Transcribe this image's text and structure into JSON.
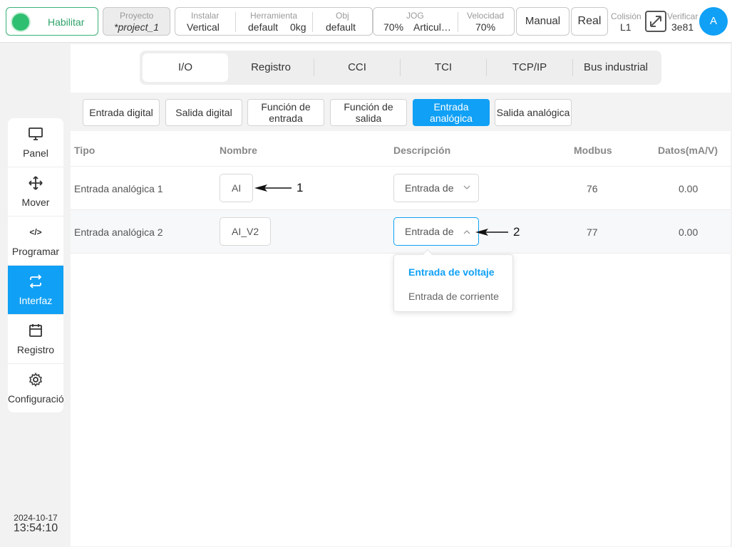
{
  "topbar": {
    "enable_label": "Habilitar",
    "project_label": "Proyecto",
    "project_value": "*project_1",
    "install_label": "Instalar",
    "install_value": "Vertical",
    "tool_label": "Herramienta",
    "tool_value": "default",
    "tool_weight": "0kg",
    "obj_label": "Obj",
    "obj_value": "default",
    "jog_label": "JOG",
    "jog_value": "70%",
    "jog_mode": "Articul…",
    "speed_label": "Velocidad",
    "speed_value": "70%",
    "manual_label": "Manual",
    "real_label": "Real",
    "collision_label": "Colisión",
    "collision_value": "L1",
    "verify_label": "Verificar",
    "verify_value": "3e81",
    "avatar_letter": "A",
    "accent_color": "#10a0f5",
    "enable_color": "#2fbf71"
  },
  "sidebar": {
    "items": [
      {
        "label": "Panel",
        "icon": "monitor-icon"
      },
      {
        "label": "Mover",
        "icon": "move-icon"
      },
      {
        "label": "Programar",
        "icon": "code-icon"
      },
      {
        "label": "Interfaz",
        "icon": "swap-icon"
      },
      {
        "label": "Registro",
        "icon": "calendar-icon"
      },
      {
        "label": "Configuración",
        "icon": "gear-icon"
      }
    ],
    "active": "Interfaz",
    "date": "2024-10-17",
    "time": "13:54:10"
  },
  "tabs": [
    "I/O",
    "Registro",
    "CCI",
    "TCI",
    "TCP/IP",
    "Bus industrial"
  ],
  "active_tab": "I/O",
  "subtabs": [
    "Entrada digital",
    "Salida digital",
    "Función de entrada",
    "Función de salida",
    "Entrada analógica",
    "Salida analógica"
  ],
  "active_subtab": "Entrada analógica",
  "table": {
    "headers": [
      "Tipo",
      "Nombre",
      "Descripción",
      "Modbus",
      "Datos(mA/V)"
    ],
    "rows": [
      {
        "type": "Entrada analógica 1",
        "name": "AI",
        "description": "Entrada de",
        "modbus": "76",
        "data": "0.00"
      },
      {
        "type": "Entrada analógica 2",
        "name": "AI_V2",
        "description": "Entrada de",
        "modbus": "77",
        "data": "0.00"
      }
    ]
  },
  "dropdown": {
    "options": [
      "Entrada de voltaje",
      "Entrada de corriente"
    ],
    "selected": "Entrada de voltaje"
  },
  "annotations": [
    "1",
    "2"
  ]
}
